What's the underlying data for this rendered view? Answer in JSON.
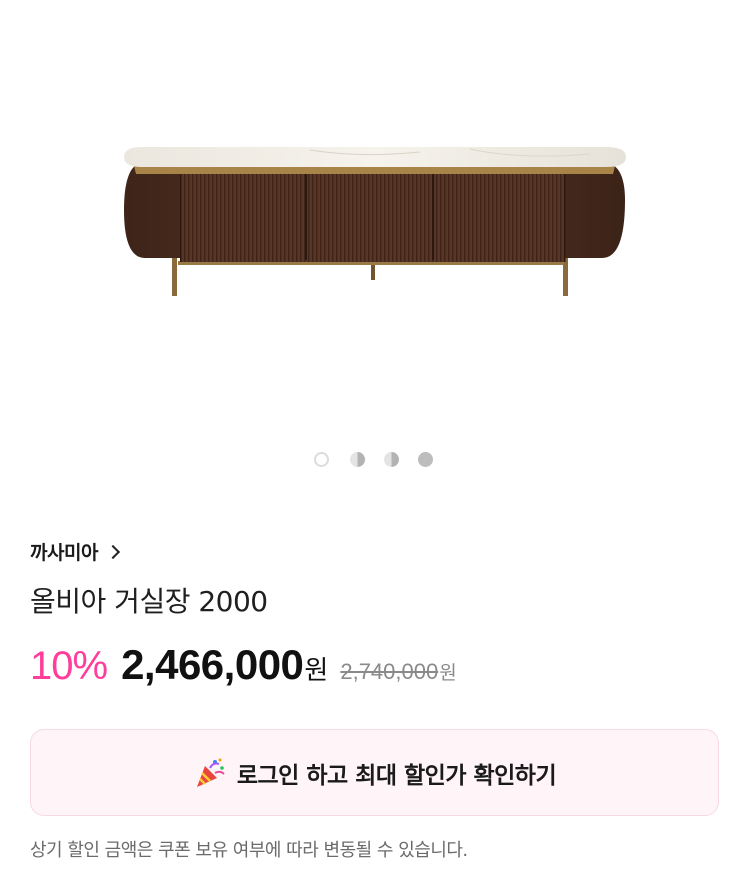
{
  "carousel": {
    "image_alt": "TV cabinet product image",
    "pages": 4,
    "active_index": 0
  },
  "brand": {
    "name": "까사미아"
  },
  "product": {
    "title": "올비아 거실장 2000"
  },
  "price": {
    "discount": "10%",
    "sale": "2,466,000",
    "sale_unit": "원",
    "original": "2,740,000",
    "original_unit": "원"
  },
  "login_banner": {
    "icon": "party-popper-icon",
    "text": "로그인 하고 최대 할인가 확인하기"
  },
  "notice": {
    "text": "상기 할인 금액은 쿠폰 보유 여부에 따라 변동될 수 있습니다."
  },
  "colors": {
    "discount": "#ff3d9a",
    "banner_bg": "#fff4f8",
    "banner_border": "#f8d9e6"
  }
}
